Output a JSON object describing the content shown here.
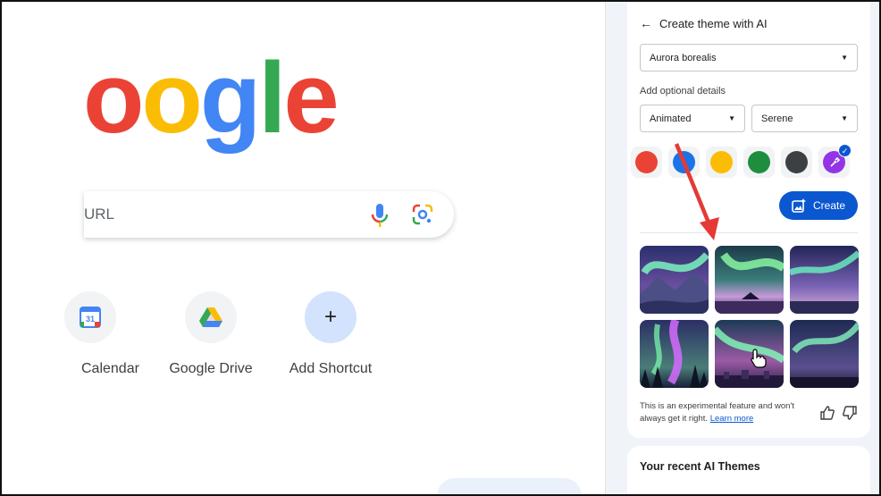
{
  "ntp": {
    "logo_letters": [
      "o",
      "o",
      "g",
      "l",
      "e"
    ],
    "logo_colors": [
      "#ea4335",
      "#fbbc05",
      "#4285f4",
      "#34a853",
      "#ea4335"
    ],
    "search_placeholder": "URL",
    "shortcuts": [
      {
        "label": "Calendar",
        "icon": "google-calendar-icon"
      },
      {
        "label": "Google Drive",
        "icon": "google-drive-icon"
      },
      {
        "label": "Add Shortcut",
        "icon": "plus-icon",
        "glyph": "+"
      }
    ]
  },
  "panel": {
    "back_icon": "←",
    "title": "Create theme with AI",
    "subject_value": "Aurora borealis",
    "details_label": "Add optional details",
    "style_value": "Animated",
    "mood_value": "Serene",
    "colors": [
      {
        "name": "red",
        "hex": "#ea4335"
      },
      {
        "name": "blue",
        "hex": "#1a73e8"
      },
      {
        "name": "yellow",
        "hex": "#fbbc04"
      },
      {
        "name": "green",
        "hex": "#1e8e3e"
      },
      {
        "name": "grey",
        "hex": "#3c4043"
      },
      {
        "name": "custom",
        "hex": "#9334e6"
      }
    ],
    "create_label": "Create",
    "disclaimer_text": "This is an experimental feature and won't always get it right.",
    "learn_more_label": "Learn more",
    "recent_title": "Your recent AI Themes"
  }
}
